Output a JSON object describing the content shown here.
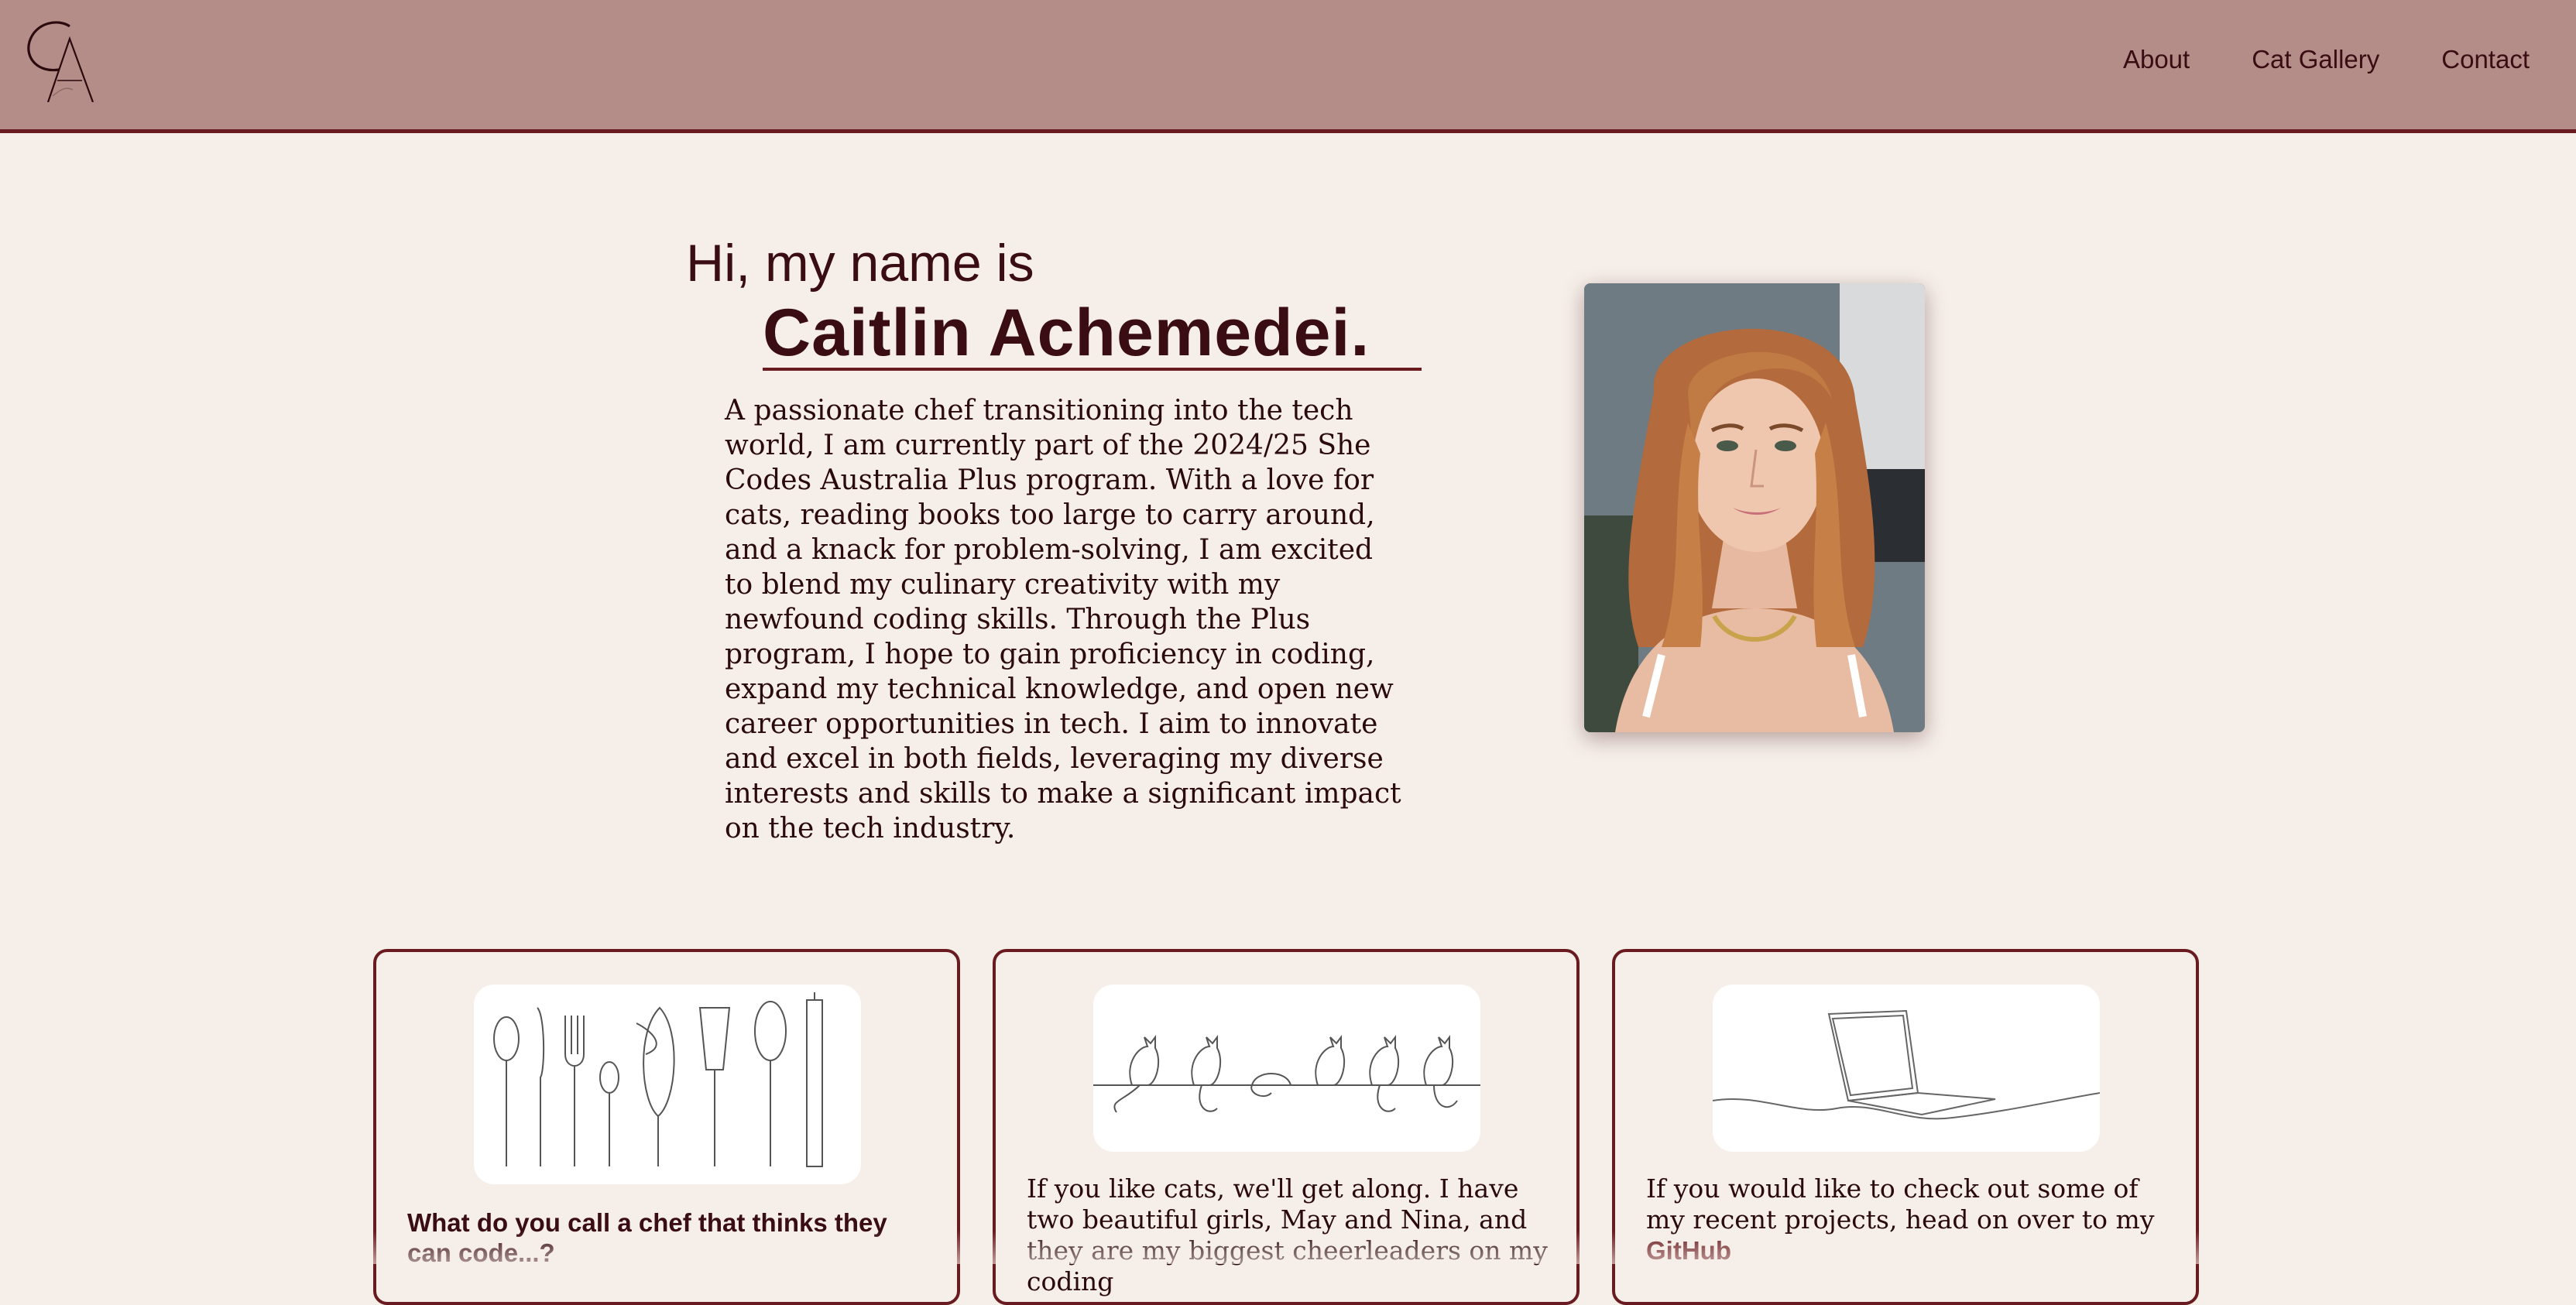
{
  "header": {
    "logo_text": "CA",
    "nav": [
      {
        "label": "About"
      },
      {
        "label": "Cat Gallery"
      },
      {
        "label": "Contact"
      }
    ]
  },
  "hero": {
    "greeting": "Hi, my name is",
    "name": "Caitlin Achemedei.",
    "bio": "A passionate chef transitioning into the tech world, I am currently part of the 2024/25 She Codes Australia Plus program. With a love for cats, reading books too large to carry around, and a knack for problem-solving, I am excited to blend my culinary creativity with my newfound coding skills. Through the Plus program, I hope to gain proficiency in coding, expand my technical knowledge, and open new career opportunities in tech. I aim to innovate and excel in both fields, leveraging my diverse interests and skills to make a significant impact on the tech industry."
  },
  "cards": [
    {
      "title": "What do you call a chef that thinks they can code...?"
    },
    {
      "text": "If you like cats, we'll get along. I have two beautiful girls, May and Nina, and they are my biggest cheerleaders on my coding"
    },
    {
      "text_before": "If you would like to check out some of my recent projects, head on over to my ",
      "link": "GitHub"
    }
  ],
  "colors": {
    "header_bg": "#b48c88",
    "page_bg": "#f6efe9",
    "accent": "#6a1b1f",
    "text": "#3a0d12"
  }
}
